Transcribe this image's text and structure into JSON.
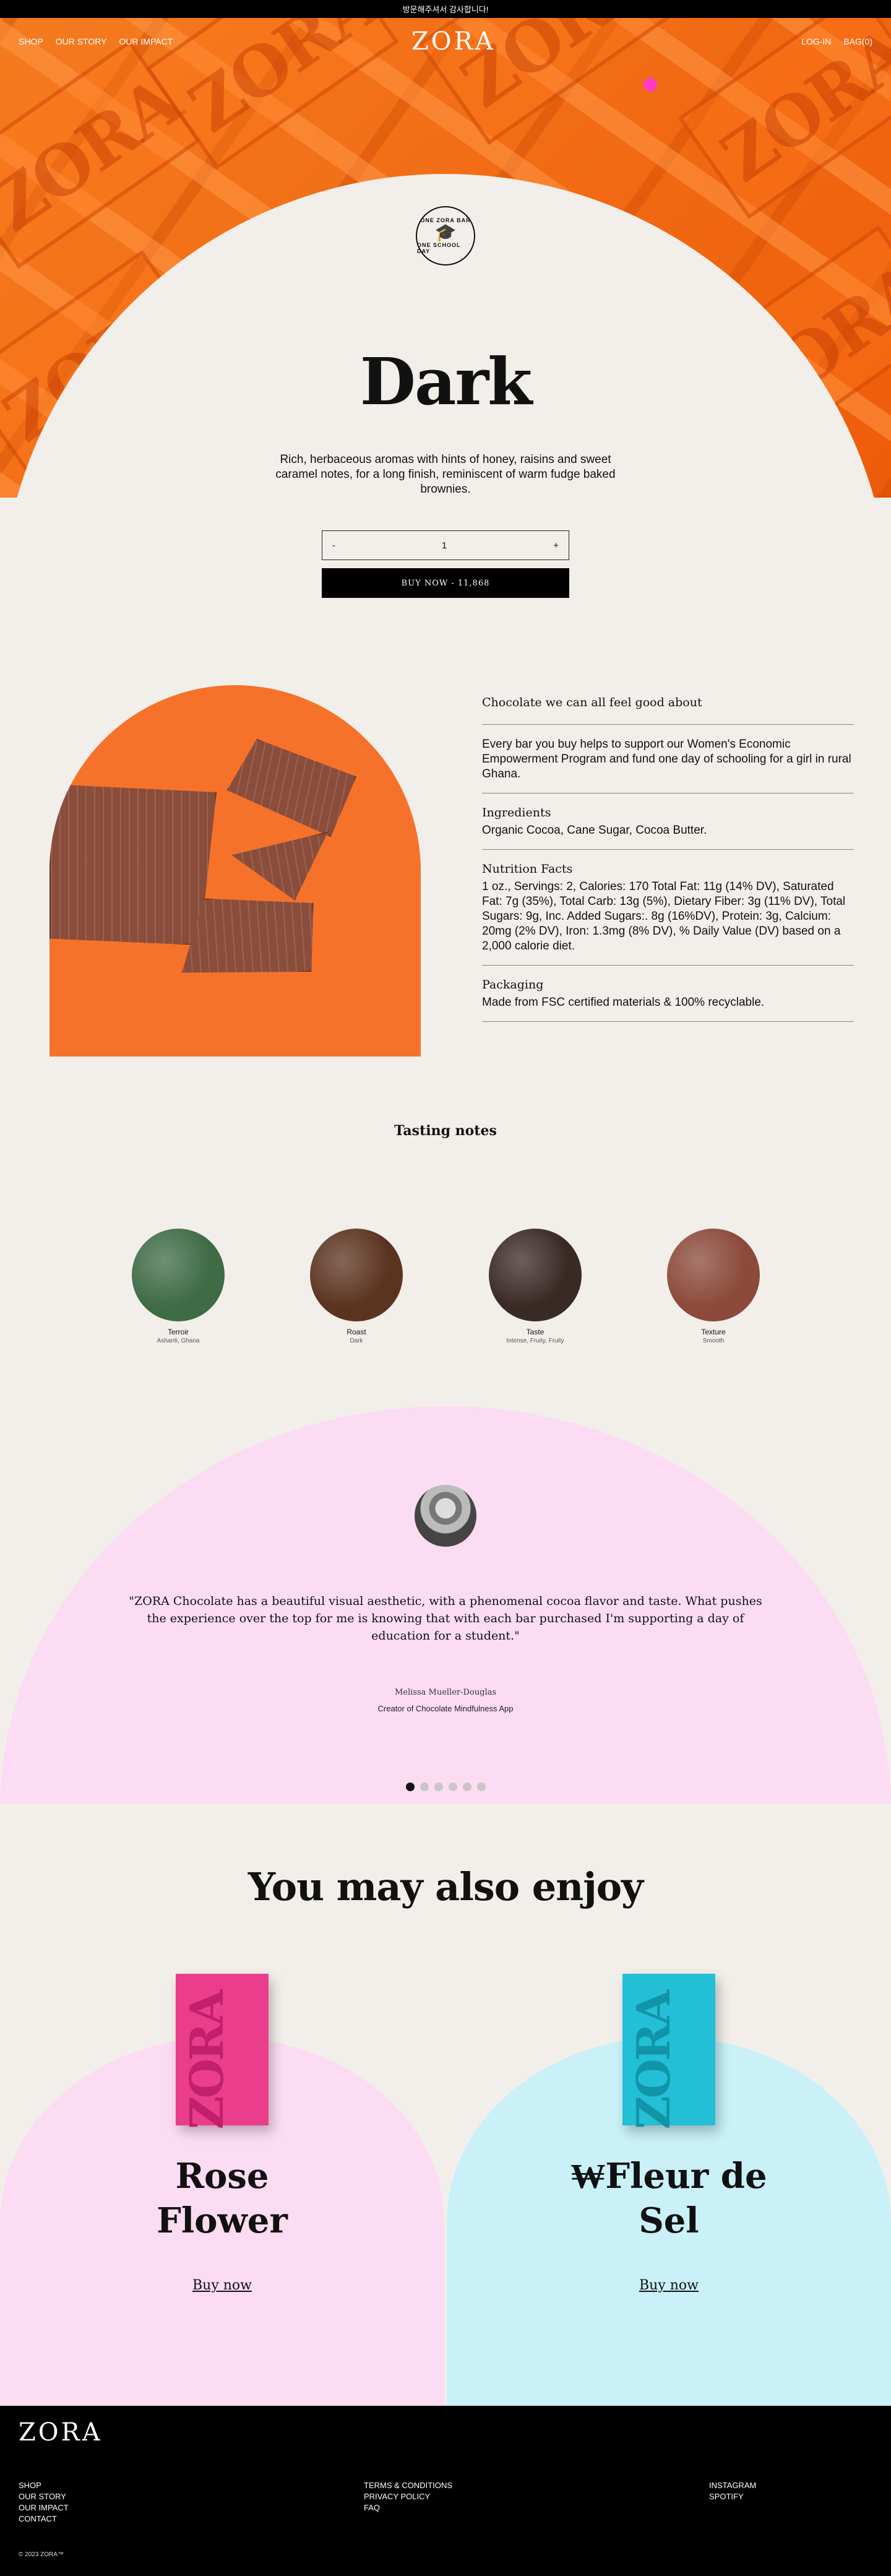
{
  "announcement": "방문해주셔서 감사합니다!",
  "nav": {
    "left": [
      "SHOP",
      "OUR STORY",
      "OUR IMPACT"
    ],
    "logo": "ZORA",
    "login": "LOG-IN",
    "bag": "BAG(0)"
  },
  "hero": {
    "bar_text": "ZORA",
    "badge": {
      "top": "ONE ZORA BAR",
      "bottom": "ONE SCHOOL DAY"
    }
  },
  "product": {
    "title": "Dark",
    "description": "Rich, herbaceous aromas with hints of honey, raisins and sweet caramel notes, for a long finish, reminiscent of warm fudge baked brownies.",
    "qty_minus": "-",
    "qty_value": "1",
    "qty_plus": "+",
    "buy_label": "BUY NOW - 11,868"
  },
  "facts": {
    "heading": "Chocolate we can all feel good about",
    "intro": "Every bar you buy helps to support our Women's Economic Empowerment Program and fund one day of schooling for a girl in rural Ghana.",
    "ingredients_title": "Ingredients",
    "ingredients": "Organic Cocoa, Cane Sugar, Cocoa Butter.",
    "nutrition_title": "Nutrition Facts",
    "nutrition": "1 oz., Servings: 2, Calories: 170 Total Fat: 11g (14% DV), Saturated Fat: 7g (35%), Total Carb: 13g (5%), Dietary Fiber: 3g (11% DV), Total Sugars: 9g, Inc. Added Sugars:. 8g (16%DV), Protein: 3g, Calcium: 20mg (2% DV), Iron: 1.3mg (8% DV), % Daily Value (DV) based on a 2,000 calorie diet.",
    "packaging_title": "Packaging",
    "packaging": "Made from FSC certified materials & 100% recyclable."
  },
  "tasting": {
    "title": "Tasting notes",
    "items": [
      {
        "name": "Terroir",
        "sub": "Ashanti, Ghana",
        "color": "#3f6b45"
      },
      {
        "name": "Roast",
        "sub": "Dark",
        "color": "#5b3420"
      },
      {
        "name": "Taste",
        "sub": "Intense, Fruity, Fruity",
        "color": "#3a2a26"
      },
      {
        "name": "Texture",
        "sub": "Smooth",
        "color": "#8b4a3a"
      }
    ]
  },
  "testimonial": {
    "quote": "\"ZORA Chocolate has a beautiful visual aesthetic, with a phenomenal cocoa flavor and taste. What pushes the experience over the top for me is knowing that with each bar purchased I'm supporting a day of education for a student.\"",
    "author": "Melissa Mueller-Douglas",
    "role": "Creator of Chocolate Mindfulness App",
    "dot_count": 6,
    "active_dot": 0
  },
  "enjoy": {
    "title": "You may also enjoy",
    "items": [
      {
        "name_line1": "Rose",
        "name_line2": "Flower",
        "buy": "Buy now",
        "pack_color": "#ea3d8b",
        "pack_text_color": "#c21f6c"
      },
      {
        "name_line1": "₩Fleur de",
        "name_line2": "Sel",
        "buy": "Buy now",
        "pack_color": "#23bfd6",
        "pack_text_color": "#1294a8"
      }
    ]
  },
  "footer": {
    "logo": "ZORA",
    "col1": [
      "SHOP",
      "OUR STORY",
      "OUR IMPACT",
      "CONTACT"
    ],
    "col2": [
      "TERMS & CONDITIONS",
      "PRIVACY POLICY",
      "FAQ"
    ],
    "col3": [
      "INSTAGRAM",
      "SPOTIFY"
    ],
    "copyright": "© 2023 ZORA™"
  }
}
